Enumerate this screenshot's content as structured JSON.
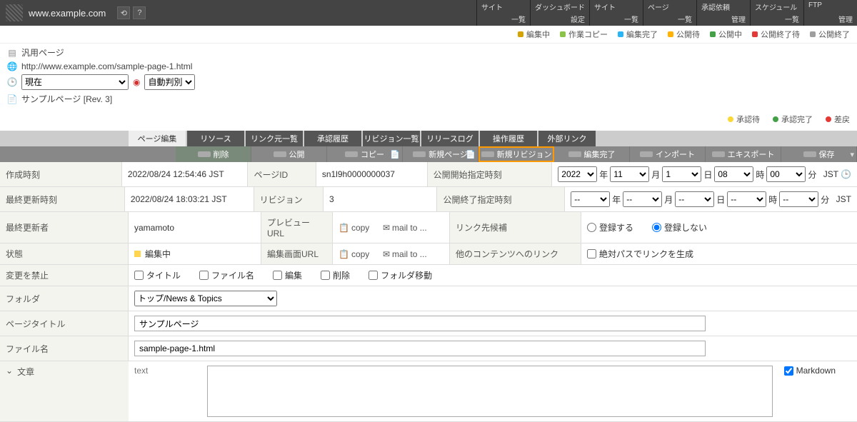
{
  "topbar": {
    "url": "www.example.com",
    "tabs": [
      {
        "label": "サイト",
        "sub": "一覧"
      },
      {
        "label": "ダッシュボード",
        "sub": "設定"
      },
      {
        "label": "サイト",
        "sub": "一覧"
      },
      {
        "label": "ページ",
        "sub": "一覧"
      },
      {
        "label": "承認依頼",
        "sub": "管理"
      },
      {
        "label": "スケジュール",
        "sub": "一覧"
      },
      {
        "label": "FTP",
        "sub": "管理"
      }
    ]
  },
  "legend": [
    {
      "color": "#d4a300",
      "label": "編集中"
    },
    {
      "color": "#8bc34a",
      "label": "作業コピー"
    },
    {
      "color": "#29b6f6",
      "label": "編集完了"
    },
    {
      "color": "#ffb300",
      "label": "公開待"
    },
    {
      "color": "#43a047",
      "label": "公開中"
    },
    {
      "color": "#e53935",
      "label": "公開終了待"
    },
    {
      "color": "#9e9e9e",
      "label": "公開終了"
    }
  ],
  "legend2": [
    {
      "color": "#fdd835",
      "label": "承認待"
    },
    {
      "color": "#43a047",
      "label": "承認完了"
    },
    {
      "color": "#e53935",
      "label": "差戻"
    }
  ],
  "info": {
    "page_type": "汎用ページ",
    "full_url": "http://www.example.com/sample-page-1.html",
    "time_select": "現在",
    "auto_detect": "自動判別",
    "sample_page": "サンプルページ [Rev. 3]"
  },
  "tabs": [
    "ページ編集",
    "リソース",
    "リンク元一覧",
    "承認履歴",
    "リビジョン一覧",
    "リリースログ",
    "操作履歴",
    "外部リンク"
  ],
  "toolbar": [
    "削除",
    "公開",
    "コピー",
    "新規ページ",
    "新規リビジョン",
    "編集完了",
    "インポート",
    "エキスポート",
    "保存"
  ],
  "form": {
    "labels": {
      "created": "作成時刻",
      "updated": "最終更新時刻",
      "updater": "最終更新者",
      "state": "状態",
      "lock": "変更を禁止",
      "folder": "フォルダ",
      "title": "ページタイトル",
      "filename": "ファイル名",
      "body": "文章",
      "page_id": "ページID",
      "revision": "リビジョン",
      "preview_url": "プレビューURL",
      "edit_url": "編集画面URL",
      "pub_start": "公開開始指定時刻",
      "pub_end": "公開終了指定時刻",
      "link_cand": "リンク先候補",
      "other_link": "他のコンテンツへのリンク"
    },
    "values": {
      "created": "2022/08/24 12:54:46 JST",
      "updated": "2022/08/24 18:03:21 JST",
      "updater": "yamamoto",
      "state": "編集中",
      "page_id": "sn1l9h0000000037",
      "revision": "3",
      "copy": "copy",
      "mailto": "mail to ...",
      "folder": "トップ/News & Topics",
      "title": "サンプルページ",
      "filename": "sample-page-1.html",
      "body_side": "text",
      "markdown": "Markdown"
    },
    "date_units": {
      "year": "年",
      "month": "月",
      "day": "日",
      "hour": "時",
      "min": "分",
      "tz": "JST"
    },
    "pub_start": {
      "year": "2022",
      "month": "11",
      "day": "1",
      "hour": "08",
      "min": "00"
    },
    "pub_end_placeholder": "--",
    "lock_opts": [
      "タイトル",
      "ファイル名",
      "編集",
      "削除",
      "フォルダ移動"
    ],
    "link_cand_opts": {
      "register": "登録する",
      "no_register": "登録しない"
    },
    "other_link_opt": "絶対パスでリンクを生成"
  }
}
